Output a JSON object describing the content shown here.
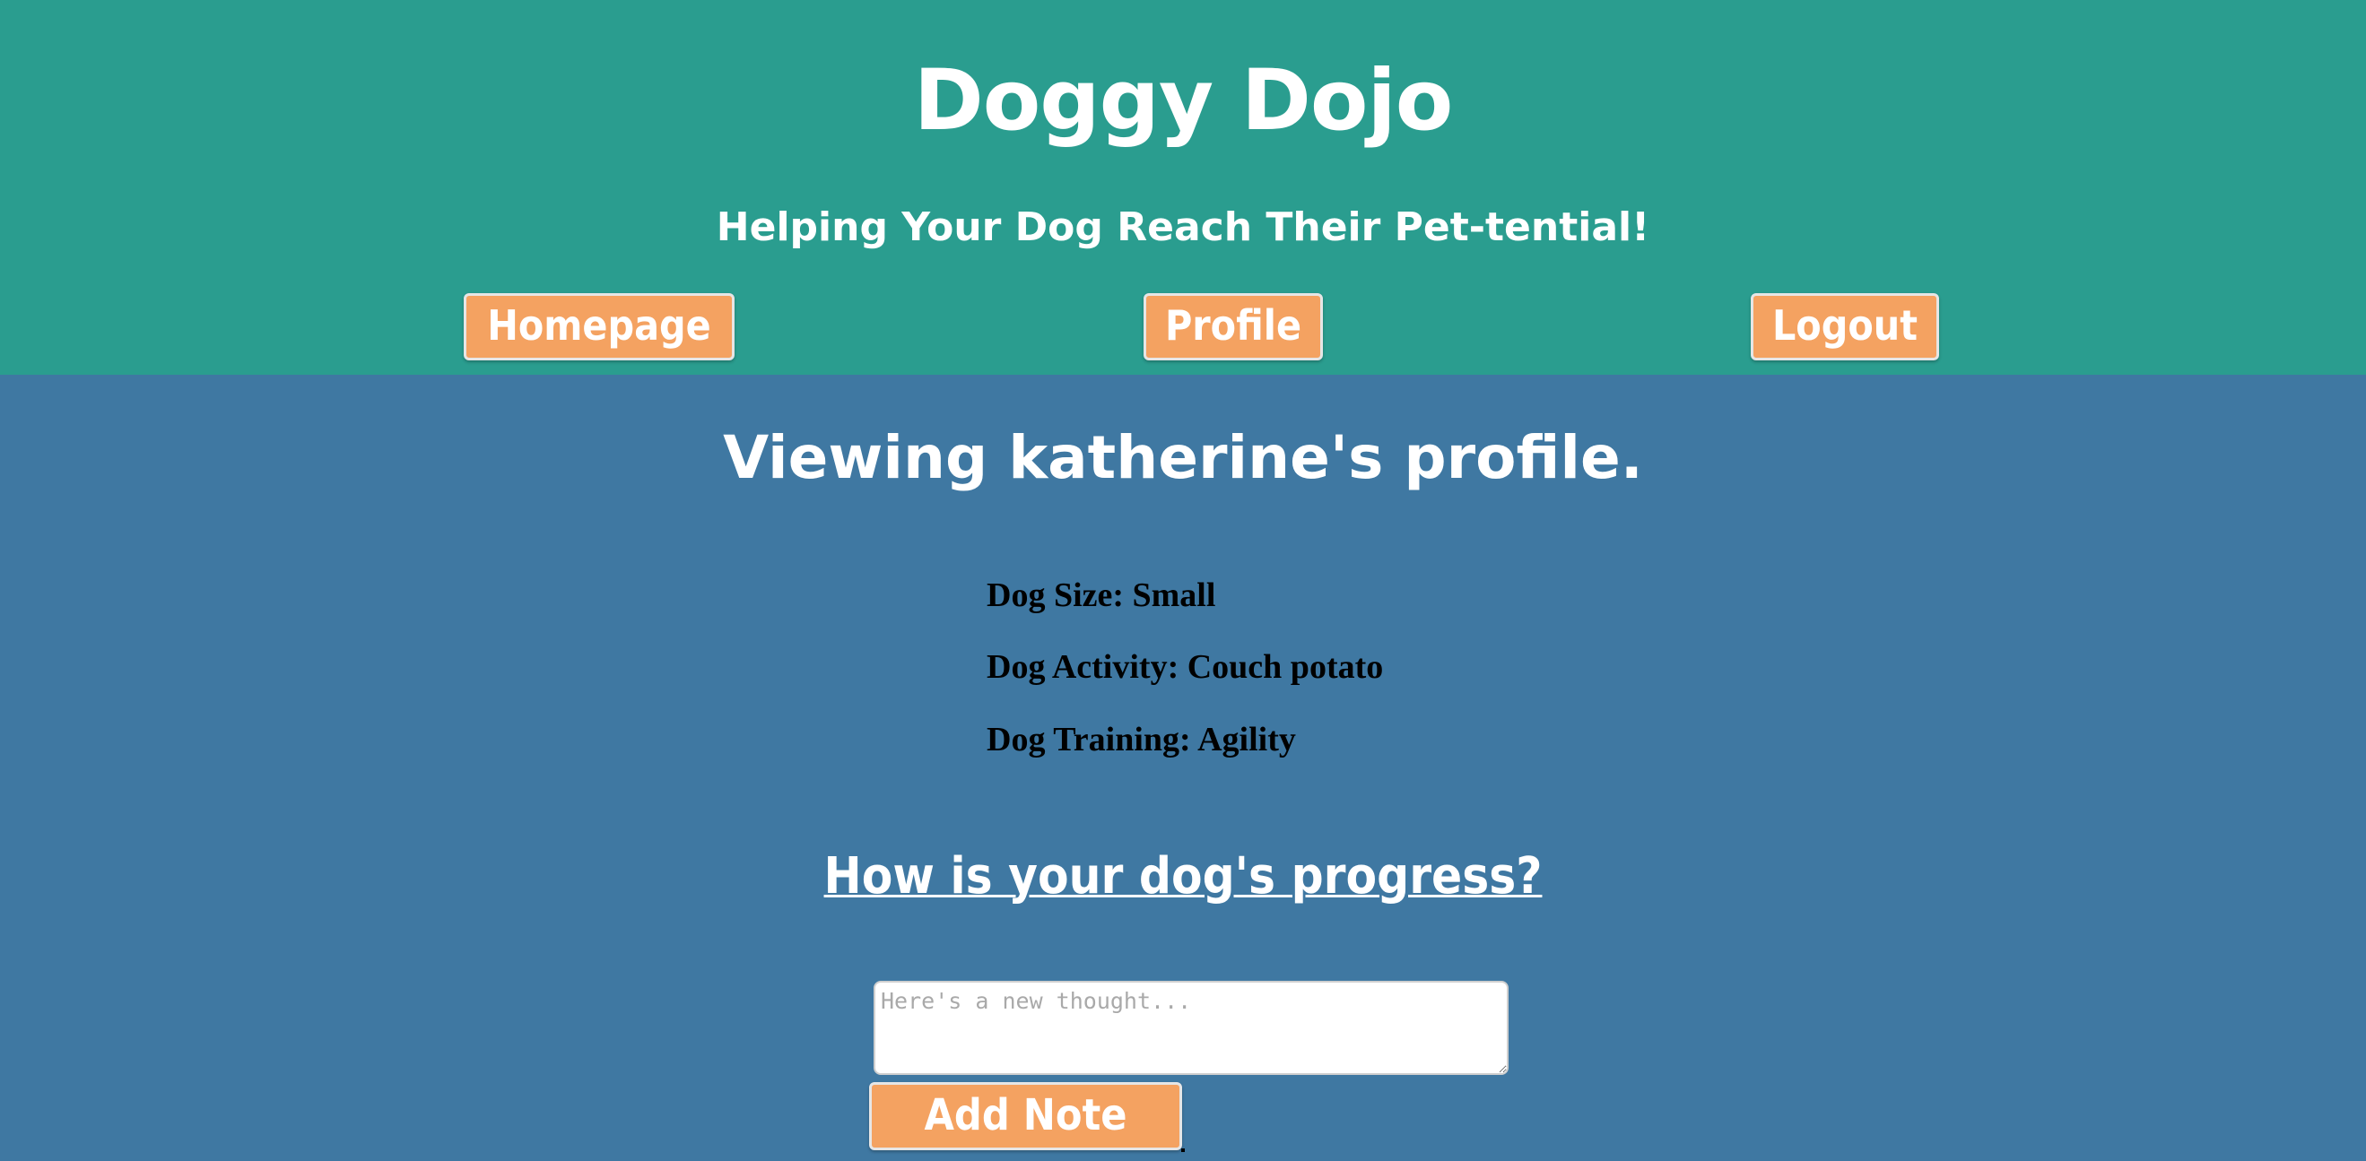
{
  "header": {
    "title": "Doggy Dojo",
    "tagline": "Helping Your Dog Reach Their Pet-tential!",
    "nav": {
      "homepage": "Homepage",
      "profile": "Profile",
      "logout": "Logout"
    }
  },
  "main": {
    "heading": "Viewing katherine's profile.",
    "details": [
      "Dog Size: Small",
      "Dog Activity: Couch potato",
      "Dog Training: Agility"
    ],
    "progress_heading": "How is your dog's progress?",
    "note_placeholder": "Here's a new thought...",
    "add_note_label": "Add Note"
  },
  "colors": {
    "header_bg": "#2a9d8f",
    "page_bg": "#3f78a2",
    "button_bg": "#f4a261"
  }
}
